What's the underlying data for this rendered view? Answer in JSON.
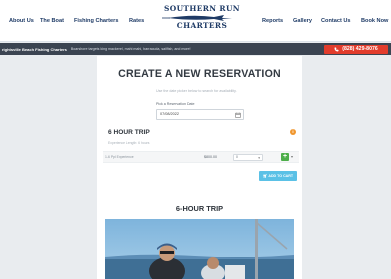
{
  "nav": {
    "links_left": [
      "About Us",
      "The Boat",
      "Fishing Charters",
      "Rates"
    ],
    "links_right": [
      "Reports",
      "Gallery",
      "Contact Us",
      "Book Now"
    ],
    "logo_top": "SOUTHERN RUN",
    "logo_bottom": "CHARTERS"
  },
  "info_bar": {
    "title": "rightsville Beach Fishing Charters",
    "text": "Boarshore targets king mackerel, mahi mahi, barracuda, sailfish, and more!",
    "phone": "(828) 429-8076"
  },
  "reservation": {
    "title": "CREATE A NEW RESERVATION",
    "helper": "Use the date picker below to search for availability.",
    "date_label": "Pick a Reservation Date",
    "date_value": "07/08/2022",
    "trip_title": "6 HOUR TRIP",
    "experience": "Experience Length: 6 hours",
    "row_label": "1-6 Ppl Experience",
    "row_price": "$800.00",
    "qty_value": "0",
    "add_to_cart": "ADD TO CART"
  },
  "section": {
    "title": "6-HOUR TRIP"
  },
  "colors": {
    "brand_navy": "#1f3b66",
    "info_bar": "#3b4451",
    "phone_red": "#e23c2c",
    "add_button": "#4dae4a",
    "cart_button": "#5bc1e6",
    "info_orange": "#f0962d"
  }
}
